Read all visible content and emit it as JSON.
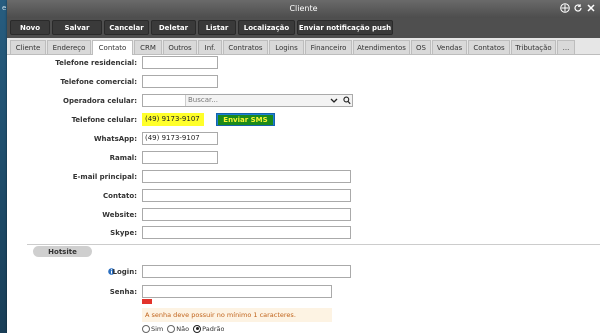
{
  "background": {
    "partial_text": "e"
  },
  "window": {
    "title": "Cliente"
  },
  "toolbar": {
    "buttons": [
      "Novo",
      "Salvar",
      "Cancelar",
      "Deletar",
      "Listar",
      "Localização",
      "Enviar notificação push"
    ]
  },
  "tabs": [
    "Cliente",
    "Endereço",
    "Contato",
    "CRM",
    "Outros",
    "Inf.",
    "Contratos",
    "Logins",
    "Financeiro",
    "Atendimentos",
    "OS",
    "Vendas",
    "Contatos",
    "Tributação",
    "..."
  ],
  "active_tab": "Contato",
  "form": {
    "telefone_residencial": {
      "label": "Telefone residencial:",
      "value": ""
    },
    "telefone_comercial": {
      "label": "Telefone comercial:",
      "value": ""
    },
    "operadora_celular": {
      "label": "Operadora celular:",
      "placeholder": "Buscar..."
    },
    "telefone_celular": {
      "label": "Telefone celular:",
      "value": "(49) 9173-9107"
    },
    "enviar_sms": "Enviar SMS",
    "whatsapp": {
      "label": "WhatsApp:",
      "value": "(49) 9173-9107"
    },
    "ramal": {
      "label": "Ramal:",
      "value": ""
    },
    "email_principal": {
      "label": "E-mail principal:",
      "value": ""
    },
    "contato": {
      "label": "Contato:",
      "value": ""
    },
    "website": {
      "label": "Website:",
      "value": ""
    },
    "skype": {
      "label": "Skype:",
      "value": ""
    }
  },
  "hotsite": {
    "section_label": "Hotsite",
    "login_label": "Login:",
    "senha_label": "Senha:",
    "senha_hint": "A senha deve possuir no mínimo 1 caracteres.",
    "radio_options": [
      "Sim",
      "Não",
      "Padrão"
    ],
    "radio_selected": "Padrão"
  },
  "colors": {
    "accent_button": "#1e7ed6",
    "sms_label_bg": "#1b8a1b",
    "highlight": "#ffff2a"
  }
}
